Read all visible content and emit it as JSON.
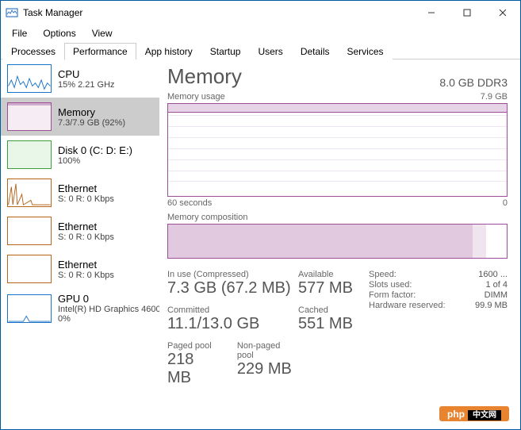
{
  "window": {
    "title": "Task Manager"
  },
  "menu": {
    "file": "File",
    "options": "Options",
    "view": "View"
  },
  "tabs": [
    "Processes",
    "Performance",
    "App history",
    "Startup",
    "Users",
    "Details",
    "Services"
  ],
  "active_tab": 1,
  "sidebar": [
    {
      "name": "CPU",
      "sub": "15% 2.21 GHz",
      "type": "cpu"
    },
    {
      "name": "Memory",
      "sub": "7.3/7.9 GB (92%)",
      "type": "mem",
      "selected": true
    },
    {
      "name": "Disk 0 (C: D: E:)",
      "sub": "100%",
      "type": "disk"
    },
    {
      "name": "Ethernet",
      "sub": "S: 0 R: 0 Kbps",
      "type": "eth1"
    },
    {
      "name": "Ethernet",
      "sub": "S: 0 R: 0 Kbps",
      "type": "eth2"
    },
    {
      "name": "Ethernet",
      "sub": "S: 0 R: 0 Kbps",
      "type": "eth3"
    },
    {
      "name": "GPU 0",
      "sub": "Intel(R) HD Graphics 4600",
      "sub2": "0%",
      "type": "gpu"
    }
  ],
  "main": {
    "title": "Memory",
    "spec": "8.0 GB DDR3",
    "usage_label": "Memory usage",
    "usage_max": "7.9 GB",
    "axis_left": "60 seconds",
    "axis_right": "0",
    "comp_label": "Memory composition",
    "inuse_label": "In use (Compressed)",
    "inuse_val": "7.3 GB (67.2 MB)",
    "avail_label": "Available",
    "avail_val": "577 MB",
    "committed_label": "Committed",
    "committed_val": "11.1/13.0 GB",
    "cached_label": "Cached",
    "cached_val": "551 MB",
    "paged_label": "Paged pool",
    "paged_val": "218 MB",
    "nonpaged_label": "Non-paged pool",
    "nonpaged_val": "229 MB",
    "kv": [
      {
        "k": "Speed:",
        "v": "1600 ..."
      },
      {
        "k": "Slots used:",
        "v": "1 of 4"
      },
      {
        "k": "Form factor:",
        "v": "DIMM"
      },
      {
        "k": "Hardware reserved:",
        "v": "99.9 MB"
      }
    ]
  },
  "badge": {
    "a": "php",
    "b": "中文网"
  },
  "chart_data": {
    "type": "area",
    "title": "Memory usage",
    "ylabel": "GB",
    "ylim": [
      0,
      7.9
    ],
    "xlabel": "seconds ago",
    "xlim": [
      60,
      0
    ],
    "series": [
      {
        "name": "In use",
        "values_constant_approx": 7.3
      }
    ],
    "composition": {
      "in_use_gb": 7.3,
      "modified_gb_est": 0.3,
      "standby_free_gb_est": 0.3,
      "total_gb": 7.9
    }
  }
}
